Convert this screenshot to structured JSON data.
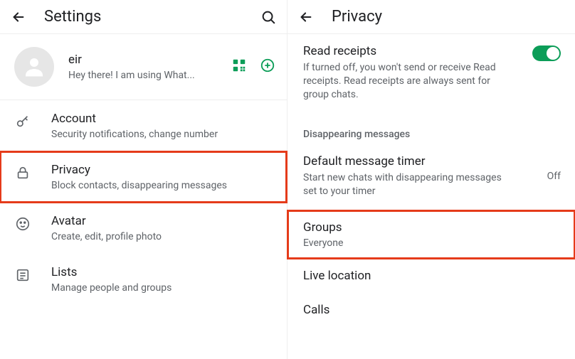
{
  "left": {
    "title": "Settings",
    "profile": {
      "name": "eir",
      "status": "Hey there! I am using What..."
    },
    "items": [
      {
        "title": "Account",
        "subtitle": "Security notifications, change number"
      },
      {
        "title": "Privacy",
        "subtitle": "Block contacts, disappearing messages"
      },
      {
        "title": "Avatar",
        "subtitle": "Create, edit, profile photo"
      },
      {
        "title": "Lists",
        "subtitle": "Manage people and groups"
      }
    ]
  },
  "right": {
    "title": "Privacy",
    "readReceipts": {
      "title": "Read receipts",
      "description": "If turned off, you won't send or receive Read receipts. Read receipts are always sent for group chats.",
      "enabled": true
    },
    "disappearing": {
      "header": "Disappearing messages",
      "timer": {
        "title": "Default message timer",
        "description": "Start new chats with disappearing messages set to your timer",
        "value": "Off"
      }
    },
    "rows": [
      {
        "title": "Groups",
        "subtitle": "Everyone"
      },
      {
        "title": "Live location",
        "subtitle": ""
      },
      {
        "title": "Calls",
        "subtitle": ""
      }
    ]
  }
}
